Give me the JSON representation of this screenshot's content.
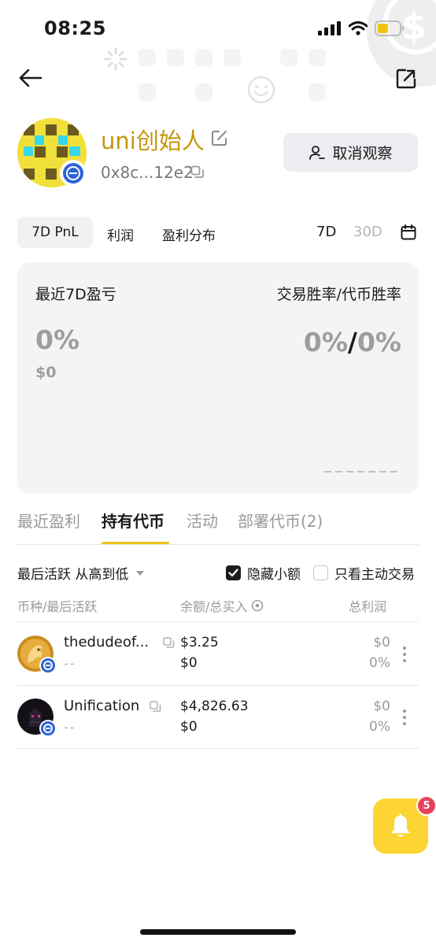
{
  "status_bar": {
    "time": "08:25"
  },
  "profile": {
    "name": "uni创始人",
    "address": "0x8c...12e2",
    "watch_button": "取消观察"
  },
  "period_tabs": {
    "tabs": [
      "7D PnL",
      "利润",
      "盈利分布"
    ],
    "active": "7D PnL",
    "ranges": [
      "7D",
      "30D"
    ],
    "active_range": "7D"
  },
  "pnl_card": {
    "left_title": "最近7D盈亏",
    "left_percent": "0%",
    "left_usd": "$0",
    "right_title": "交易胜率/代币胜率",
    "right_trade_rate": "0%",
    "right_separator": "/",
    "right_token_rate": "0%"
  },
  "section_tabs": {
    "items": [
      "最近盈利",
      "持有代币",
      "活动",
      "部署代币(2)"
    ],
    "active": "持有代币"
  },
  "filters": {
    "sort_label": "最后活跃 从高到低",
    "hide_small": {
      "label": "隐藏小额",
      "checked": true
    },
    "active_only": {
      "label": "只看主动交易",
      "checked": false
    }
  },
  "columns": [
    "币种/最后活跃",
    "余额/总买入",
    "总利润"
  ],
  "tokens": [
    {
      "name": "thedudeof...",
      "last_active": "--",
      "balance": "$3.25",
      "total_buy": "$0",
      "profit": "$0",
      "profit_pct": "0%"
    },
    {
      "name": "Unification",
      "last_active": "--",
      "balance": "$4,826.63",
      "total_buy": "$0",
      "profit": "$0",
      "profit_pct": "0%"
    }
  ],
  "notifications": {
    "count": "5"
  },
  "colors": {
    "accent_yellow": "#fcd535",
    "name_gold": "#c4960c",
    "badge_blue": "#2d63d8",
    "alert_red": "#e8425a"
  }
}
